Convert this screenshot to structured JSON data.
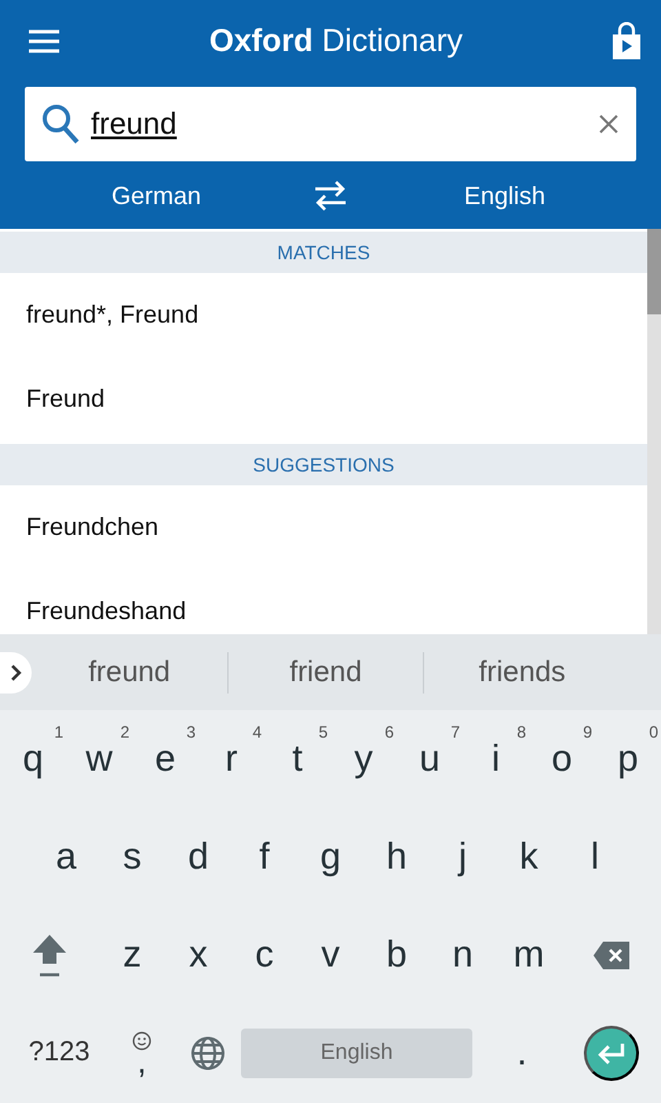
{
  "app_bar": {
    "title": "**Oxford** Dictionary"
  },
  "search": {
    "value": "freund"
  },
  "languages": {
    "source": "German",
    "target": "English"
  },
  "sections": [
    {
      "heading": "MATCHES",
      "items": [
        "freund*, Freund",
        "Freund"
      ]
    },
    {
      "heading": "SUGGESTIONS",
      "items": [
        "Freundchen",
        "Freundeshand"
      ]
    }
  ],
  "keyboard": {
    "suggestions": [
      "freund",
      "friend",
      "friends"
    ],
    "rows": [
      [
        {
          "key": "q",
          "hint": "1"
        },
        {
          "key": "w",
          "hint": "2"
        },
        {
          "key": "e",
          "hint": "3"
        },
        {
          "key": "r",
          "hint": "4"
        },
        {
          "key": "t",
          "hint": "5"
        },
        {
          "key": "y",
          "hint": "6"
        },
        {
          "key": "u",
          "hint": "7"
        },
        {
          "key": "i",
          "hint": "8"
        },
        {
          "key": "o",
          "hint": "9"
        },
        {
          "key": "p",
          "hint": "0"
        }
      ],
      [
        {
          "key": "a"
        },
        {
          "key": "s"
        },
        {
          "key": "d"
        },
        {
          "key": "f"
        },
        {
          "key": "g"
        },
        {
          "key": "h"
        },
        {
          "key": "j"
        },
        {
          "key": "k"
        },
        {
          "key": "l"
        }
      ],
      [
        {
          "key": "z"
        },
        {
          "key": "x"
        },
        {
          "key": "c"
        },
        {
          "key": "v"
        },
        {
          "key": "b"
        },
        {
          "key": "n"
        },
        {
          "key": "m"
        }
      ]
    ],
    "symbols_key": "?123",
    "comma_key": ",",
    "space_key": "English",
    "period_key": "."
  }
}
